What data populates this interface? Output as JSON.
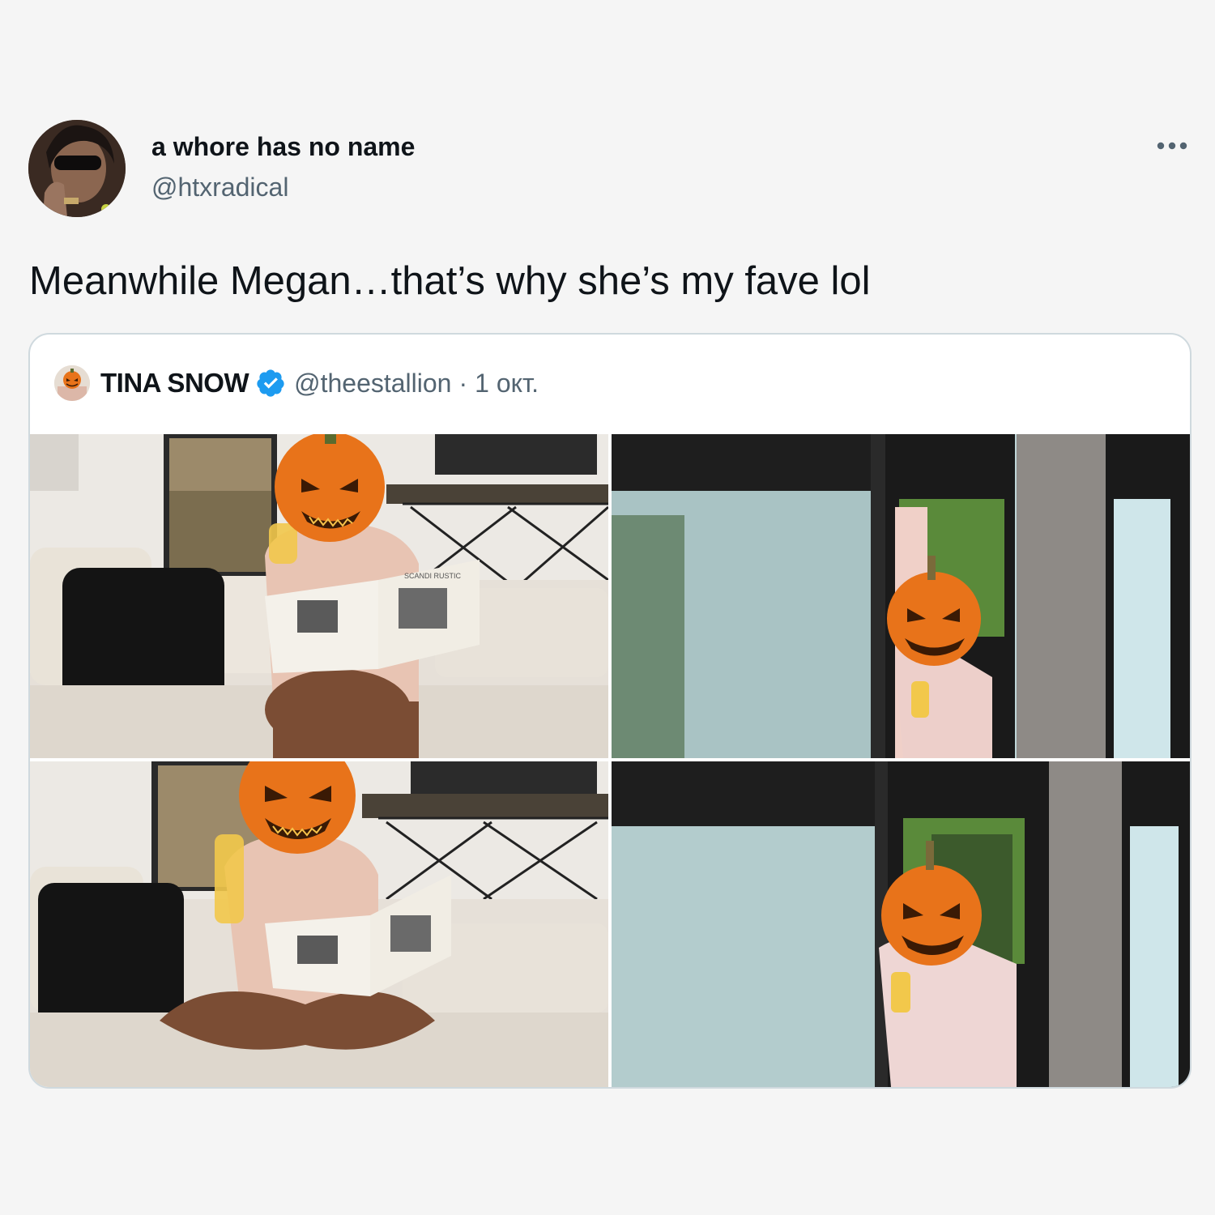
{
  "tweet": {
    "author": {
      "name": "a whore has no name",
      "handle": "@htxradical"
    },
    "text": "Meanwhile Megan…that’s why she’s my fave lol",
    "more_icon": "more-horizontal-icon"
  },
  "quoted_tweet": {
    "author": {
      "name": "TINA SNOW",
      "handle": "@theestallion",
      "verified": true
    },
    "separator": "·",
    "date": "1 окт.",
    "photos": [
      {
        "id": "photo-1",
        "book_title": "SCANDI RUSTIC"
      },
      {
        "id": "photo-2"
      },
      {
        "id": "photo-3"
      },
      {
        "id": "photo-4"
      }
    ]
  },
  "colors": {
    "background": "#f5f5f5",
    "card": "#ffffff",
    "border": "#cfd9de",
    "secondary_text": "#536471",
    "verified_blue": "#1d9bf0",
    "pumpkin": "#e8731a"
  }
}
